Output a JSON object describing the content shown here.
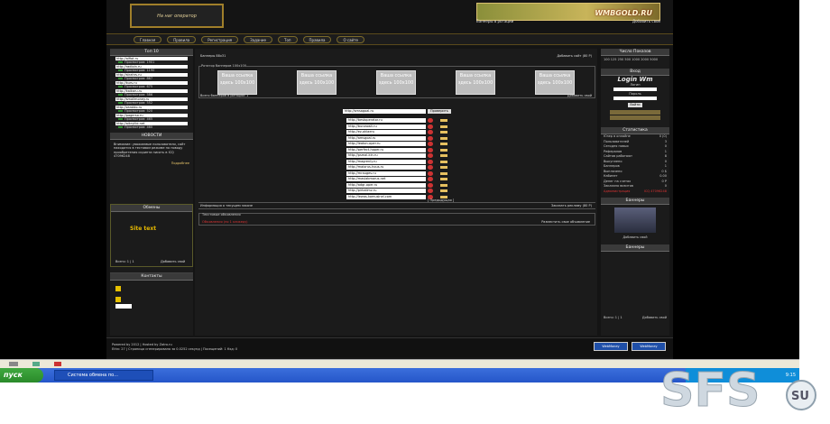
{
  "logo": {
    "text": "На наг оператор"
  },
  "banner": {
    "text": "WMBGOLD.RU",
    "left_link": "Баннеры в ротации",
    "right_link": "Добавить свой"
  },
  "nav": [
    "Главная",
    "Правила",
    "Регистрация",
    "Задание",
    "Топ",
    "Правила",
    "О сайте"
  ],
  "left": {
    "top_title": "Топ 10",
    "top": [
      {
        "url": "http://alfiot.ru",
        "views": "Просмотров: 1901"
      },
      {
        "url": "http://radioin.ru",
        "views": "Просмотров: 1190"
      },
      {
        "url": "http://strahrs.ru",
        "views": "Просмотров: 867"
      },
      {
        "url": "http://kurs.ru",
        "views": "Просмотров: 675"
      },
      {
        "url": "http://kaikaru.ru",
        "views": "Просмотров: 586"
      },
      {
        "url": "http://smallmoney.ru",
        "views": "Просмотров: 552"
      },
      {
        "url": "http://zaroblo.ru",
        "views": "Просмотров: 520"
      },
      {
        "url": "http://pagerso.ru",
        "views": "Просмотров: 465"
      },
      {
        "url": "http://aikrylibi.net",
        "views": "Просмотров: 460"
      }
    ],
    "news_title": "НОВОСТИ",
    "news_text": "Внимание: уважаемые пользователи, сайт находится в тестовом режиме по поводу приобретения скрипта писать в ICQ 47096248",
    "news_more": "Подробнее",
    "obmen_title": "Обмены",
    "site_text": "Site text",
    "pages": "Всего: 1 | 1",
    "add": "Добавить свой",
    "contacts_title": "Контакты"
  },
  "main": {
    "header_left": "Баннеры 88x31",
    "header_add": "Добавить сайт (80 P)",
    "banners_label": "Ротатор баннеров 100x100",
    "slots": [
      "Ваша ссылка\nздесь 100x100",
      "Ваша ссылка\nздесь 100x100",
      "Ваша ссылка\nздесь 100x100",
      "Ваша ссылка\nздесь 100x100",
      "Ваша ссылка\nздесь 100x100"
    ],
    "rotation": "Всего баннеров в ротации: 1",
    "add_own": "Добавить свой",
    "input_url": "http://smsagoal.ru",
    "go": "Проверить",
    "links": [
      "http://bestoperator.ru",
      "http://burzaosit.ru",
      "http://ez-oklaeru",
      "http://amsgoal.ru",
      "http://leaton-oper.ru",
      "http://perfect-hoper.ru",
      "http://psmal-kin.ru",
      "http://magrenly.ru",
      "http://maiorus-hous.ru",
      "http://mrauges.ru",
      "http://maslabmarus.net",
      "http://adgr-oper.ru",
      "http://pirkalimz.ru",
      "http://lewas-komusinel.com"
    ],
    "pages_text": "[ Предыдущая ]",
    "info_left": "Информация о текущем заказе",
    "info_right": "Заказать рекламу (80 P)",
    "obj_title": "Текстовые объявления",
    "obj_left": "Объявления (по 1 кликеру)",
    "obj_right": "Разместить свое объявление"
  },
  "right": {
    "search_title": "Число Показов",
    "search_vals": "100 125 250 500 1000 2000 5000",
    "login_title": "Вход",
    "login_logo": "Login Wm",
    "login_label": "Логин",
    "pass_label": "Пароль",
    "login_btn": "Войти",
    "stat_title": "Статистика",
    "stats": [
      [
        "Юзер в онлайне",
        "0 (0)"
      ],
      [
        "Пользователей",
        "3"
      ],
      [
        "Сегодня новых",
        "0"
      ],
      [
        "Рефералов",
        "1"
      ],
      [
        "Сайтов работают",
        "8"
      ],
      [
        "Выкуплено",
        "0"
      ],
      [
        "Баннеров",
        "1"
      ],
      [
        "Выплачено",
        "0 $"
      ],
      [
        "Кабинет",
        "0.00"
      ],
      [
        "Денег на счетах",
        "0 P"
      ],
      [
        "Заказано визитов",
        "0"
      ]
    ],
    "admin_label": "Администрация",
    "admin_val": "ICQ 47096248",
    "b1_title": "Баннеры",
    "b1_add": "Добавить свой",
    "b2_title": "Баннеры",
    "pages": "Всего: 1 | 1",
    "add": "Добавить свой"
  },
  "footer": {
    "copy": "Powered by 2012 | Hosted by Zatro.ru",
    "line2": "Ethn: 27 | Страница сгенерирована за 0.0252 секунд | Посещений: 1 Кэд: 0",
    "wm1": "WebMoney",
    "wm2": "WebMoney"
  },
  "taskbar": {
    "start": "пуск",
    "window": "Система обмена по...",
    "clock": "9:15"
  },
  "watermark": {
    "text": "SFS",
    "suffix": "SU"
  }
}
